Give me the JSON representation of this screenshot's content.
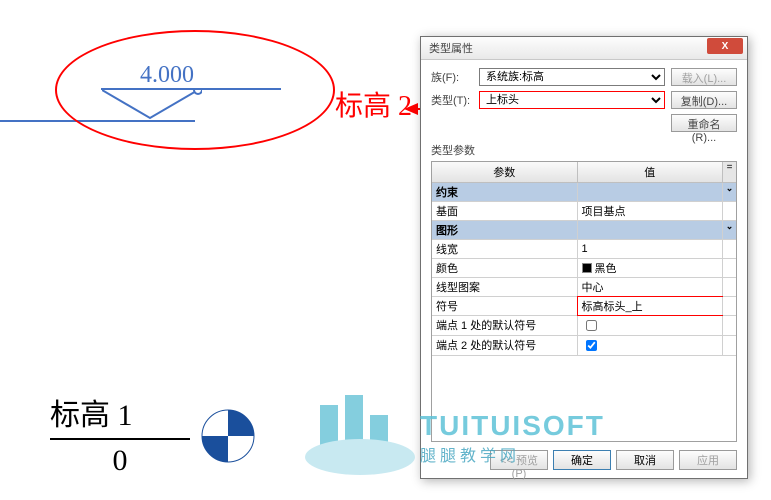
{
  "level2": {
    "value": "4.000",
    "label": "标高 2"
  },
  "level1": {
    "label": "标高 1",
    "value": "0"
  },
  "dialog": {
    "title": "类型属性",
    "close": "X",
    "family_lbl": "族(F):",
    "family_val": "系统族:标高",
    "type_lbl": "类型(T):",
    "type_val": "上标头",
    "btn_load": "载入(L)...",
    "btn_copy": "复制(D)...",
    "btn_rename": "重命名(R)...",
    "section": "类型参数",
    "head_param": "参数",
    "head_value": "值",
    "head_eq": "=",
    "groups": {
      "g1": "约束",
      "g2": "图形"
    },
    "rows": {
      "basis_lbl": "基面",
      "basis_val": "项目基点",
      "lw_lbl": "线宽",
      "lw_val": "1",
      "color_lbl": "颜色",
      "color_val": "黑色",
      "pattern_lbl": "线型图案",
      "pattern_val": "中心",
      "symbol_lbl": "符号",
      "symbol_val": "标高标头_上",
      "d1_lbl": "端点 1 处的默认符号",
      "d2_lbl": "端点 2 处的默认符号"
    },
    "footer": {
      "preview": "<< 预览(P)",
      "ok": "确定",
      "cancel": "取消",
      "apply": "应用"
    }
  },
  "watermark": {
    "brand": "TUITUISOFT",
    "sub": "腿腿教学网"
  }
}
